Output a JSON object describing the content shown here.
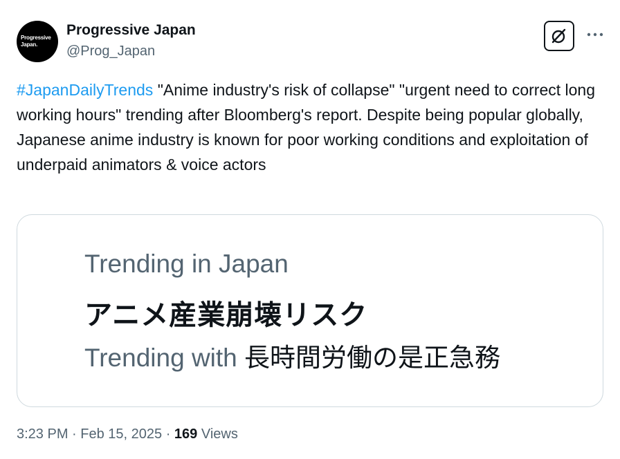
{
  "author": {
    "avatar_line1": "Progressive",
    "avatar_line2": "Japan.",
    "display_name": "Progressive Japan",
    "handle": "@Prog_Japan"
  },
  "actions": {
    "grok_icon": "grok-icon",
    "more_icon": "more-dots-icon"
  },
  "tweet": {
    "hashtag": "#JapanDailyTrends",
    "text": " \"Anime industry's risk of collapse\" \"urgent need to correct long working hours\" trending after Bloomberg's report. Despite being popular globally, Japanese anime industry is known for poor working conditions and exploitation of underpaid animators & voice actors"
  },
  "card": {
    "line1": "Trending in Japan",
    "line2": "アニメ産業崩壊リスク",
    "line3_label": "Trending with ",
    "line3_topic": "長時間労働の是正急務"
  },
  "meta": {
    "time": "3:23 PM",
    "separator": " · ",
    "date": "Feb 15, 2025",
    "views_count": "169",
    "views_label": " Views"
  },
  "colors": {
    "accent": "#1d9bf0",
    "text": "#0f1419",
    "secondary": "#536471",
    "border": "#cfd9de"
  }
}
